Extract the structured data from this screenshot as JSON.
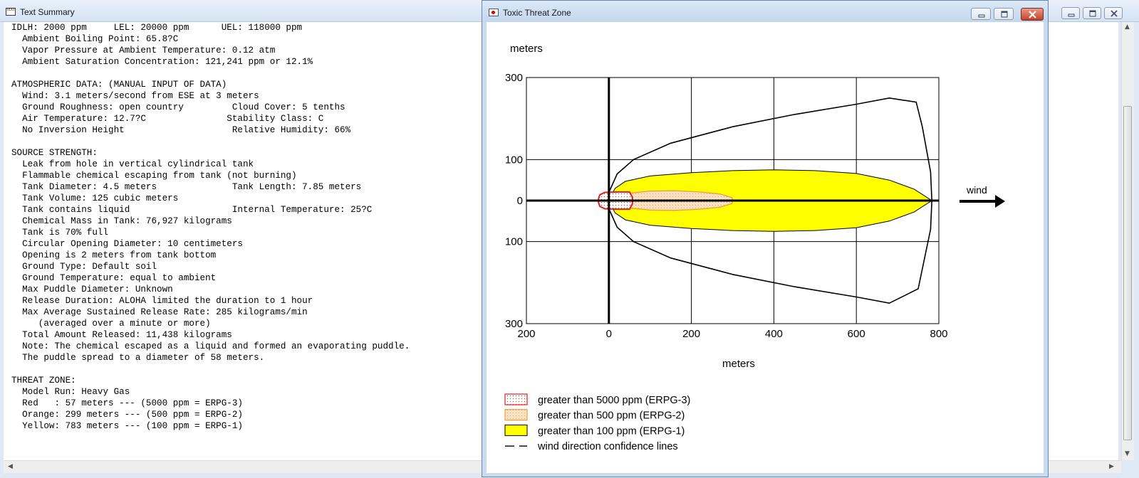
{
  "text_summary_window": {
    "title": "Text Summary",
    "lines": [
      "IDLH: 2000 ppm     LEL: 20000 ppm      UEL: 118000 ppm",
      "  Ambient Boiling Point: 65.8?C",
      "  Vapor Pressure at Ambient Temperature: 0.12 atm",
      "  Ambient Saturation Concentration: 121,241 ppm or 12.1%",
      "",
      "ATMOSPHERIC DATA: (MANUAL INPUT OF DATA)",
      "  Wind: 3.1 meters/second from ESE at 3 meters",
      "  Ground Roughness: open country         Cloud Cover: 5 tenths",
      "  Air Temperature: 12.7?C               Stability Class: C",
      "  No Inversion Height                    Relative Humidity: 66%",
      "",
      "SOURCE STRENGTH:",
      "  Leak from hole in vertical cylindrical tank",
      "  Flammable chemical escaping from tank (not burning)",
      "  Tank Diameter: 4.5 meters              Tank Length: 7.85 meters",
      "  Tank Volume: 125 cubic meters",
      "  Tank contains liquid                   Internal Temperature: 25?C",
      "  Chemical Mass in Tank: 76,927 kilograms",
      "  Tank is 70% full",
      "  Circular Opening Diameter: 10 centimeters",
      "  Opening is 2 meters from tank bottom",
      "  Ground Type: Default soil",
      "  Ground Temperature: equal to ambient",
      "  Max Puddle Diameter: Unknown",
      "  Release Duration: ALOHA limited the duration to 1 hour",
      "  Max Average Sustained Release Rate: 285 kilograms/min",
      "     (averaged over a minute or more)",
      "  Total Amount Released: 11,438 kilograms",
      "  Note: The chemical escaped as a liquid and formed an evaporating puddle.",
      "  The puddle spread to a diameter of 58 meters.",
      "",
      "THREAT ZONE:",
      "  Model Run: Heavy Gas",
      "  Red   : 57 meters --- (5000 ppm = ERPG-3)",
      "  Orange: 299 meters --- (500 ppm = ERPG-2)",
      "  Yellow: 783 meters --- (100 ppm = ERPG-1)"
    ]
  },
  "threat_zone_window": {
    "title": "Toxic Threat Zone",
    "wind_label": "wind"
  },
  "chart_data": {
    "type": "area",
    "ylabel": "meters",
    "xlabel": "meters",
    "x_ticks": [
      "200",
      "0",
      "200",
      "400",
      "600",
      "800"
    ],
    "x_tick_values": [
      -200,
      0,
      200,
      400,
      600,
      800
    ],
    "y_ticks": [
      "300",
      "100",
      "0",
      "100",
      "300"
    ],
    "y_tick_values": [
      300,
      100,
      0,
      -100,
      -300
    ],
    "xlim": [
      -200,
      800
    ],
    "ylim": [
      -300,
      300
    ],
    "grid": true,
    "colors": {
      "red": "#e31c1c",
      "orange_fill": "#fde3c4",
      "orange_edge": "#f39a3c",
      "yellow": "#ffff00"
    },
    "zones": [
      {
        "name": "Red",
        "extent_m": 57,
        "polygon": [
          [
            -25,
            -5
          ],
          [
            -22,
            -14
          ],
          [
            -10,
            -20
          ],
          [
            20,
            -21
          ],
          [
            50,
            -21
          ],
          [
            57,
            -8
          ],
          [
            57,
            8
          ],
          [
            50,
            21
          ],
          [
            20,
            21
          ],
          [
            -10,
            20
          ],
          [
            -22,
            14
          ],
          [
            -25,
            5
          ]
        ]
      },
      {
        "name": "Orange",
        "extent_m": 299,
        "polygon": [
          [
            0,
            0
          ],
          [
            10,
            -11
          ],
          [
            40,
            -17
          ],
          [
            100,
            -23
          ],
          [
            160,
            -24
          ],
          [
            220,
            -21
          ],
          [
            270,
            -16
          ],
          [
            299,
            -7
          ],
          [
            299,
            7
          ],
          [
            270,
            16
          ],
          [
            220,
            21
          ],
          [
            160,
            24
          ],
          [
            100,
            23
          ],
          [
            40,
            17
          ],
          [
            10,
            11
          ]
        ]
      },
      {
        "name": "Yellow",
        "extent_m": 783,
        "polygon": [
          [
            0,
            0
          ],
          [
            15,
            -30
          ],
          [
            40,
            -47
          ],
          [
            100,
            -60
          ],
          [
            200,
            -68
          ],
          [
            300,
            -73
          ],
          [
            400,
            -75
          ],
          [
            500,
            -73
          ],
          [
            600,
            -66
          ],
          [
            680,
            -50
          ],
          [
            740,
            -28
          ],
          [
            783,
            0
          ],
          [
            740,
            28
          ],
          [
            680,
            50
          ],
          [
            600,
            66
          ],
          [
            500,
            73
          ],
          [
            400,
            75
          ],
          [
            300,
            73
          ],
          [
            200,
            68
          ],
          [
            100,
            60
          ],
          [
            40,
            47
          ],
          [
            15,
            30
          ]
        ]
      }
    ],
    "confidence_lines": [
      {
        "points": [
          [
            0,
            -20
          ],
          [
            20,
            -65
          ],
          [
            60,
            -100
          ],
          [
            150,
            -140
          ],
          [
            300,
            -180
          ],
          [
            450,
            -210
          ],
          [
            600,
            -235
          ],
          [
            680,
            -250
          ],
          [
            750,
            -215
          ],
          [
            780,
            -70
          ],
          [
            783,
            0
          ]
        ]
      },
      {
        "points": [
          [
            0,
            20
          ],
          [
            20,
            65
          ],
          [
            60,
            100
          ],
          [
            150,
            140
          ],
          [
            300,
            180
          ],
          [
            450,
            210
          ],
          [
            600,
            235
          ],
          [
            680,
            250
          ],
          [
            745,
            240
          ],
          [
            760,
            180
          ],
          [
            780,
            70
          ],
          [
            783,
            0
          ]
        ]
      }
    ],
    "legend": {
      "placement": "bottom-left",
      "entries": [
        {
          "label": "greater than 5000 ppm (ERPG-3)",
          "swatch": "red-dotted"
        },
        {
          "label": "greater than 500 ppm (ERPG-2)",
          "swatch": "orange-dotted"
        },
        {
          "label": "greater than 100 ppm (ERPG-1)",
          "swatch": "yellow-solid"
        },
        {
          "label": "wind direction confidence lines",
          "swatch": "dashed-line"
        }
      ]
    }
  }
}
